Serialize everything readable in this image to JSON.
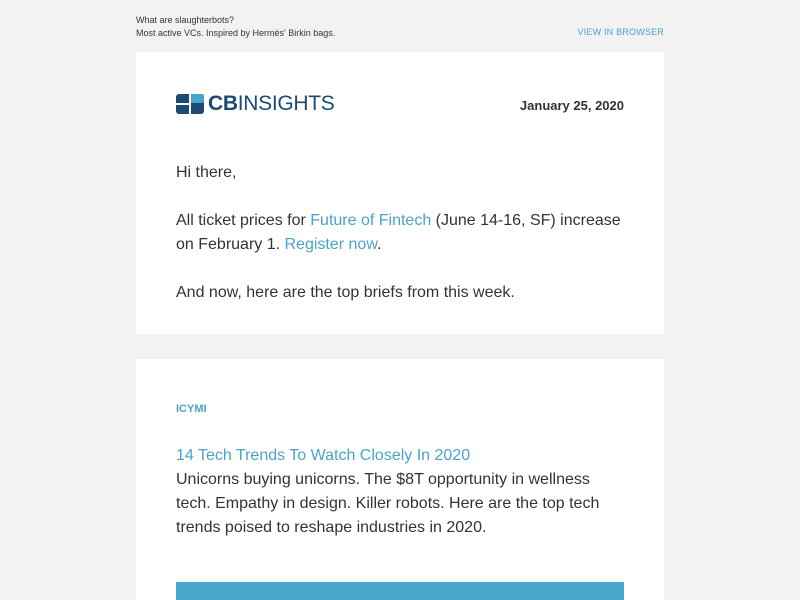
{
  "preheader": {
    "line1": "What are slaughterbots?",
    "line2": "Most active VCs. Inspired by Hermès' Birkin bags.",
    "view_in_browser": "VIEW IN BROWSER"
  },
  "header": {
    "logo_bold": "CB",
    "logo_light": "INSIGHTS",
    "date": "January 25, 2020"
  },
  "intro": {
    "greeting": "Hi there,",
    "announce_prefix": "All ticket prices for ",
    "event_link": "Future of Fintech",
    "announce_middle": " (June 14-16, SF) increase on February 1. ",
    "register_link": "Register now",
    "announce_suffix": ".",
    "briefs_line": "And now, here are the top briefs from this week."
  },
  "article": {
    "tag": "ICYMI",
    "title": "14 Tech Trends To Watch Closely In 2020",
    "description": "Unicorns buying unicorns. The $8T opportunity in wellness tech. Empathy in design. Killer robots. Here are the top tech trends poised to reshape industries in 2020."
  },
  "colors": {
    "link": "#4aa3c9",
    "brand": "#1c4a73",
    "background": "#f2f2f2"
  }
}
